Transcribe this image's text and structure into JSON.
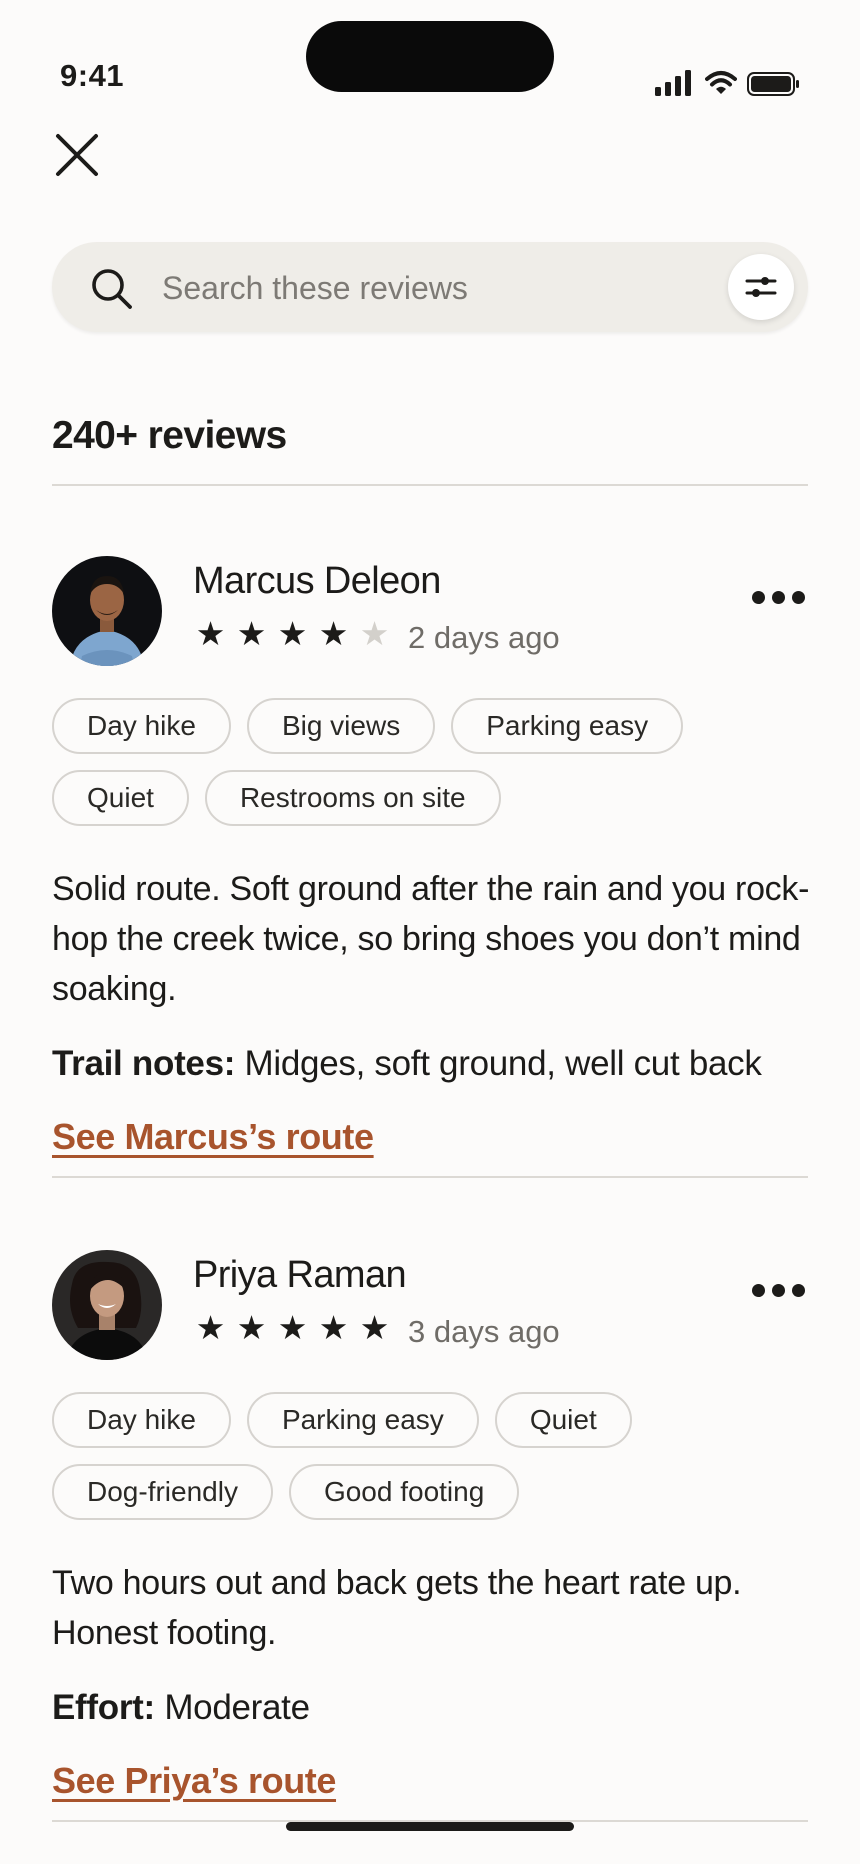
{
  "status_bar": {
    "time": "9:41"
  },
  "search": {
    "placeholder": "Search these reviews"
  },
  "reviews_heading": "240+ reviews",
  "reviews": [
    {
      "name": "Marcus Deleon",
      "rating": 4,
      "max_rating": 5,
      "date": "2 days ago",
      "tags": [
        "Day hike",
        "Big views",
        "Parking easy",
        "Quiet",
        "Restrooms on site"
      ],
      "text": "Solid route. Soft ground after the rain and you rock-hop the creek twice, so bring shoes you don’t mind soaking.",
      "note_label": "Trail notes:",
      "note_value": "Midges, soft ground, well cut back",
      "link": "See Marcus’s route"
    },
    {
      "name": "Priya Raman",
      "rating": 5,
      "max_rating": 5,
      "date": "3 days ago",
      "tags": [
        "Day hike",
        "Parking easy",
        "Quiet",
        "Dog-friendly",
        "Good footing"
      ],
      "text": "Two hours out and back gets the heart rate up. Honest footing.",
      "note_label": "Effort:",
      "note_value": "Moderate",
      "link": "See Priya’s route"
    }
  ],
  "colors": {
    "link": "#a8542d",
    "background": "#fcfbfa",
    "search_bg": "#efede8"
  }
}
